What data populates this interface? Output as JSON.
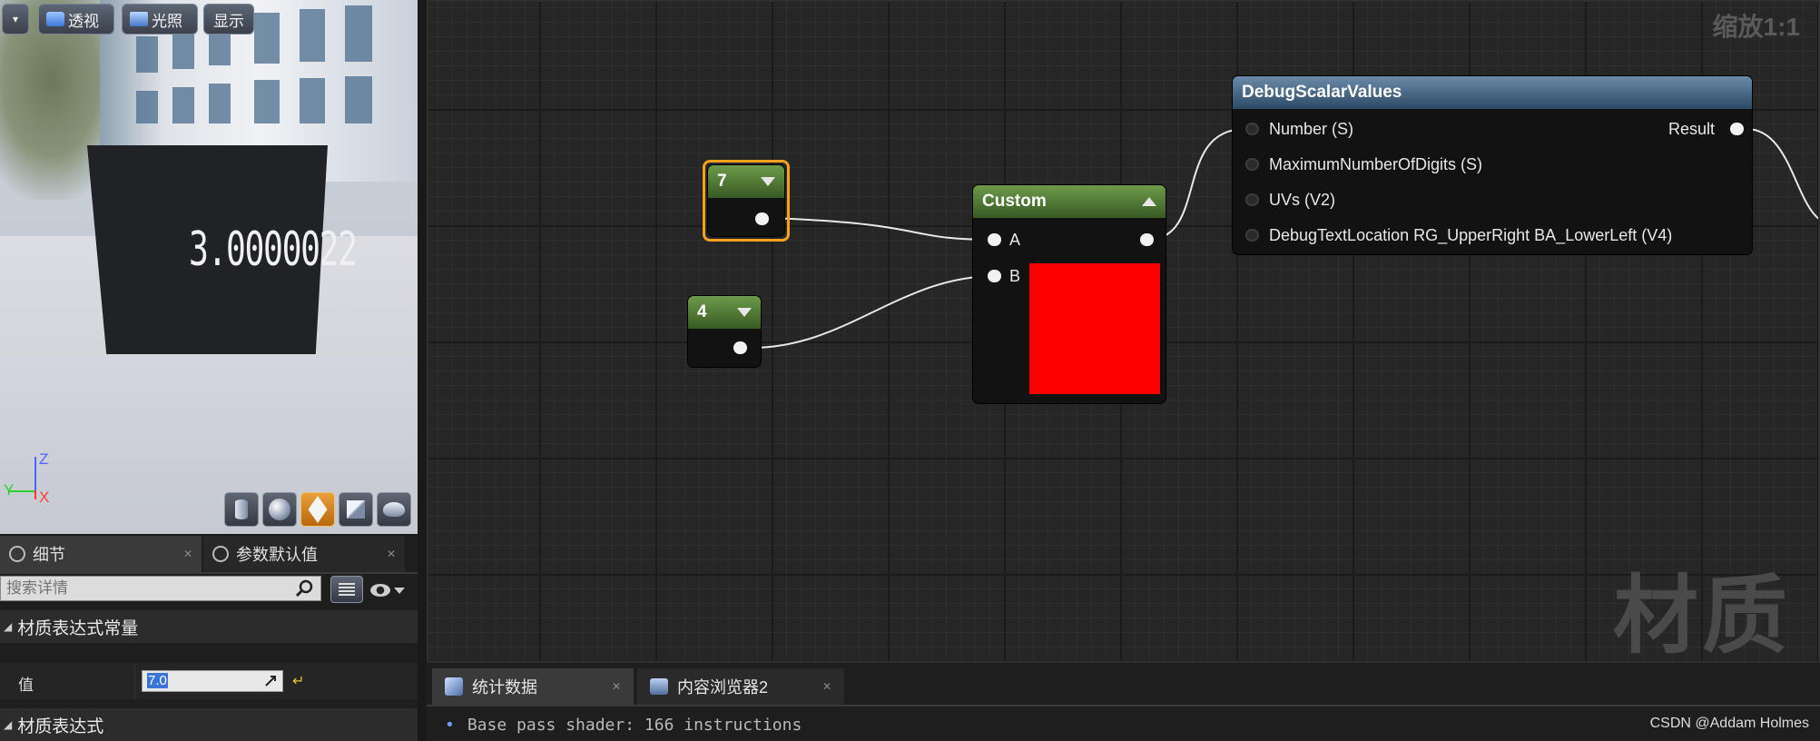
{
  "viewport": {
    "menu_arrow": "▾",
    "buttons": {
      "perspective": "透视",
      "lighting": "光照",
      "show": "显示"
    },
    "preview_text": "3.0000022",
    "axes": {
      "z": "Z",
      "x": "X",
      "y": "Y"
    },
    "preview_shapes": [
      "cylinder-icon",
      "sphere-icon",
      "plane-icon",
      "cube-icon",
      "teapot-icon"
    ],
    "active_shape_index": 2
  },
  "details": {
    "tabs": [
      {
        "label": "细节",
        "icon": "info-icon",
        "active": true
      },
      {
        "label": "参数默认值",
        "icon": "info-icon",
        "active": false
      }
    ],
    "search_placeholder": "搜索详情",
    "section_constant": "材质表达式常量",
    "value_label": "值",
    "value": "7.0",
    "section_expression": "材质表达式"
  },
  "graph": {
    "zoom_label": "缩放1:1",
    "watermark_label": "材质",
    "nodes": {
      "const7": {
        "value": "7"
      },
      "const4": {
        "value": "4"
      },
      "custom": {
        "title": "Custom",
        "inputs": [
          "A",
          "B"
        ],
        "preview_color": "#ff0000"
      },
      "debug": {
        "title": "DebugScalarValues",
        "inputs": [
          "Number (S)",
          "MaximumNumberOfDigits (S)",
          "UVs (V2)",
          "DebugTextLocation RG_UpperRight BA_LowerLeft (V4)"
        ],
        "output": "Result"
      }
    },
    "colors": {
      "selection": "#f4a11e",
      "const_header": "#6d9a4a",
      "function_header": "#2c4a66"
    }
  },
  "bottom": {
    "tabs": [
      {
        "label": "统计数据",
        "icon": "stats-icon"
      },
      {
        "label": "内容浏览器2",
        "icon": "content-browser-icon"
      }
    ],
    "log": "Base pass shader: 166 instructions",
    "watermark": "CSDN @Addam Holmes"
  }
}
